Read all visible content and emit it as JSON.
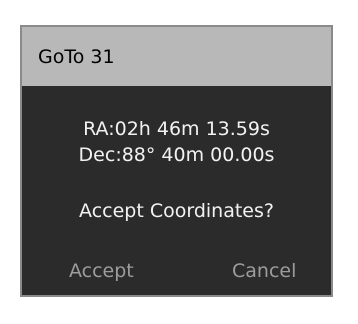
{
  "dialog": {
    "title": "GoTo 31",
    "ra": "RA:02h 46m 13.59s",
    "dec": "Dec:88° 40m 00.00s",
    "question": "Accept Coordinates?",
    "accept_label": "Accept",
    "cancel_label": "Cancel"
  },
  "colors": {
    "titlebar_bg": "#b8b8b8",
    "body_bg": "#2b2b2b",
    "text": "#f2f2f2",
    "button_text": "#9c9c9c",
    "border": "#8a8a8a"
  }
}
